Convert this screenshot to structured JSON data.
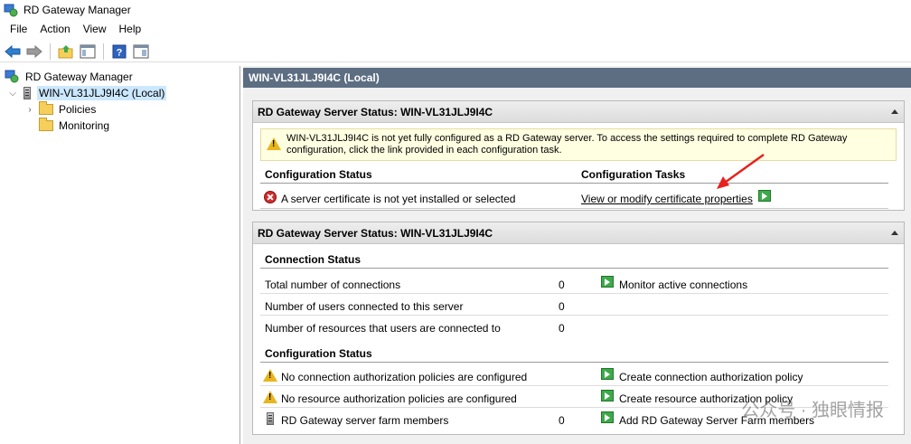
{
  "window": {
    "title": "RD Gateway Manager"
  },
  "menu": [
    "File",
    "Action",
    "View",
    "Help"
  ],
  "toolbar": {
    "back_icon": "back-arrow-icon",
    "forward_icon": "forward-arrow-icon",
    "up_icon": "up-folder-icon",
    "show_hide_icon": "show-hide-tree-icon",
    "help_icon": "help-icon",
    "help_glyph": "?",
    "action_pane_icon": "action-pane-icon"
  },
  "tree": {
    "root": "RD Gateway Manager",
    "server": "WIN-VL31JLJ9I4C (Local)",
    "children": [
      "Policies",
      "Monitoring"
    ]
  },
  "header": {
    "title": "WIN-VL31JLJ9I4C (Local)"
  },
  "panel1": {
    "title": "RD Gateway Server Status: WIN-VL31JLJ9I4C",
    "warning": "WIN-VL31JLJ9I4C is not yet fully configured as a RD Gateway server. To access the settings required to complete RD Gateway configuration, click the link provided in each configuration task.",
    "col_status": "Configuration Status",
    "col_tasks": "Configuration Tasks",
    "status_item": "A server certificate is not yet installed or selected",
    "task_link": "View or modify certificate properties"
  },
  "panel2": {
    "title": "RD Gateway Server Status: WIN-VL31JLJ9I4C",
    "connection_heading": "Connection Status",
    "rows": [
      {
        "label": "Total number of connections",
        "value": "0"
      },
      {
        "label": "Number of users connected to this server",
        "value": "0"
      },
      {
        "label": "Number of resources that users are connected to",
        "value": "0"
      }
    ],
    "monitor_link": "Monitor active connections",
    "config_heading": "Configuration Status",
    "config_rows": [
      {
        "label": "No connection authorization policies are configured",
        "value": "",
        "action": "Create connection authorization policy"
      },
      {
        "label": "No resource authorization policies are configured",
        "value": "",
        "action": "Create resource authorization policy"
      },
      {
        "label": "RD Gateway server farm members",
        "value": "0",
        "action": "Add RD Gateway Server Farm members"
      }
    ]
  },
  "watermark": "公众号 · 独眼情报",
  "colors": {
    "header_bar": "#5d6e82",
    "warning_bg": "#ffffe1",
    "selected": "#cce8ff",
    "arrow": "#e8211c"
  }
}
